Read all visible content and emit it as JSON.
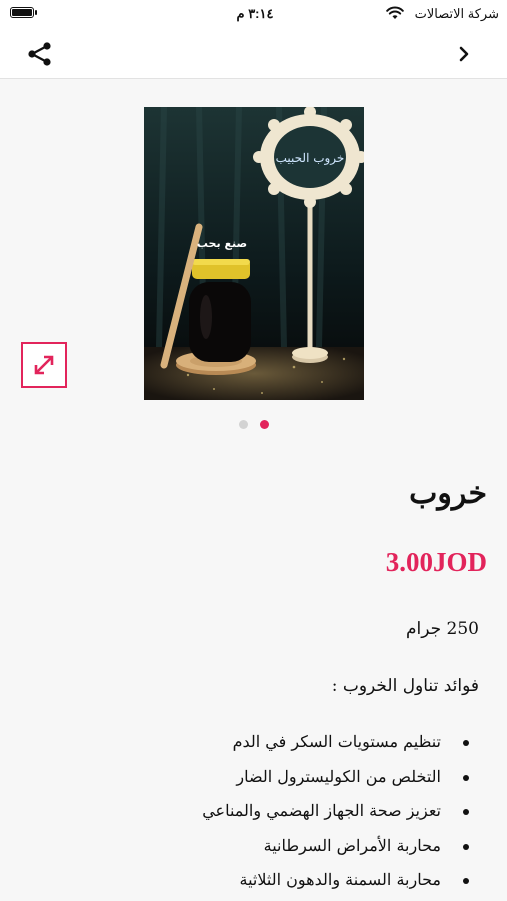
{
  "status_bar": {
    "carrier": "شركة الاتصالات",
    "time": "٣:١٤ م"
  },
  "nav": {
    "share_icon": "share-icon",
    "back_icon": "chevron-right-icon"
  },
  "product": {
    "image_caption": "صنع بحب",
    "image_sign_text": "خروب الحبيب",
    "title": "خروب",
    "price": "3.00JOD",
    "weight": "250 جرام",
    "benefits_heading": "فوائد تناول الخروب :",
    "benefits": [
      "تنظيم مستويات السكر في الدم",
      "التخلص من الكوليسترول الضار",
      "تعزيز صحة الجهاز الهضمي والمناعي",
      "محاربة الأمراض السرطانية",
      "محاربة السمنة والدهون الثلاثية"
    ]
  },
  "carousel": {
    "total": 2,
    "active_index": 1
  },
  "colors": {
    "accent": "#e2245b",
    "background": "#f7f7f7"
  }
}
